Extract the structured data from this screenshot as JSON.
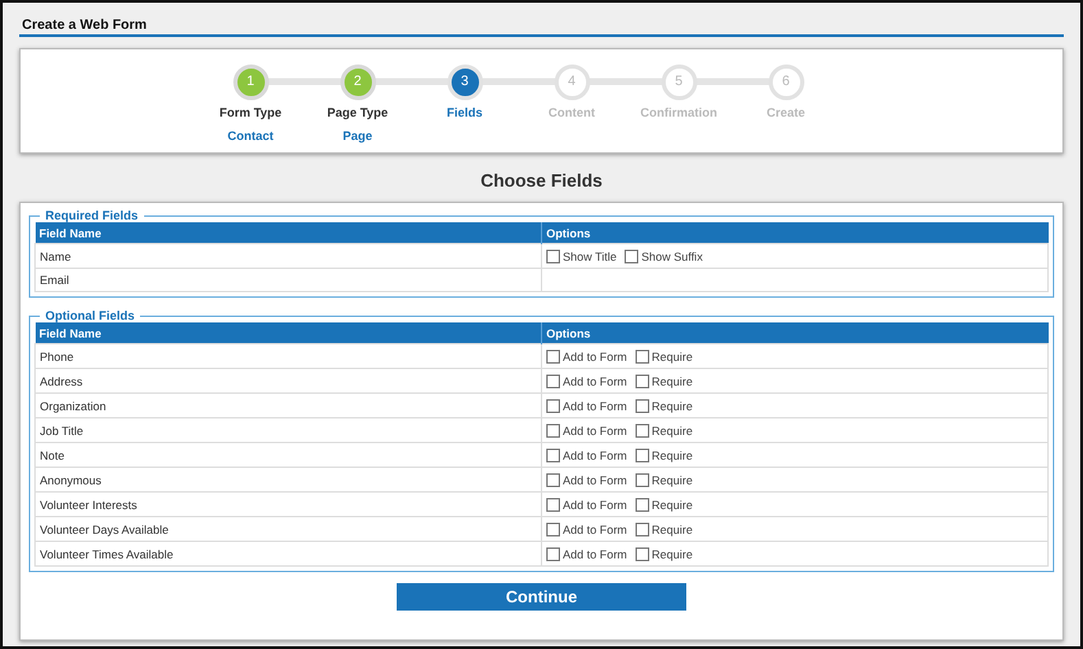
{
  "header": {
    "title": "Create a Web Form"
  },
  "steps": [
    {
      "number": "1",
      "label": "Form Type",
      "value": "Contact",
      "completed": true,
      "selected": false
    },
    {
      "number": "2",
      "label": "Page Type",
      "value": "Page",
      "completed": true,
      "selected": false
    },
    {
      "number": "3",
      "label": "Fields",
      "completed": false,
      "selected": true
    },
    {
      "number": "4",
      "label": "Content",
      "completed": false,
      "selected": false
    },
    {
      "number": "5",
      "label": "Confirmation",
      "completed": false,
      "selected": false
    },
    {
      "number": "6",
      "label": "Create",
      "completed": false,
      "selected": false
    }
  ],
  "heading": "Choose Fields",
  "sections": [
    {
      "legend": "Required Fields",
      "columns": [
        "Field Name",
        "Options"
      ],
      "rows": [
        {
          "name": "Name",
          "options": [
            {
              "label": "Show Title",
              "checked": false
            },
            {
              "label": "Show Suffix",
              "checked": false
            }
          ]
        },
        {
          "name": "Email"
        }
      ]
    },
    {
      "legend": "Optional Fields",
      "columns": [
        "Field Name",
        "Options"
      ],
      "rows": [
        {
          "name": "Phone",
          "options": [
            {
              "label": "Add to Form",
              "checked": false
            },
            {
              "label": "Require",
              "checked": false
            }
          ]
        },
        {
          "name": "Address",
          "options": [
            {
              "label": "Add to Form",
              "checked": false
            },
            {
              "label": "Require",
              "checked": false
            }
          ]
        },
        {
          "name": "Organization",
          "options": [
            {
              "label": "Add to Form",
              "checked": false
            },
            {
              "label": "Require",
              "checked": false
            }
          ]
        },
        {
          "name": "Job Title",
          "options": [
            {
              "label": "Add to Form",
              "checked": false
            },
            {
              "label": "Require",
              "checked": false
            }
          ]
        },
        {
          "name": "Note",
          "options": [
            {
              "label": "Add to Form",
              "checked": false
            },
            {
              "label": "Require",
              "checked": false
            }
          ]
        },
        {
          "name": "Anonymous",
          "options": [
            {
              "label": "Add to Form",
              "checked": false
            },
            {
              "label": "Require",
              "checked": false
            }
          ]
        },
        {
          "name": "Volunteer Interests",
          "options": [
            {
              "label": "Add to Form",
              "checked": false
            },
            {
              "label": "Require",
              "checked": false
            }
          ]
        },
        {
          "name": "Volunteer Days Available",
          "options": [
            {
              "label": "Add to Form",
              "checked": false
            },
            {
              "label": "Require",
              "checked": false
            }
          ]
        },
        {
          "name": "Volunteer Times Available",
          "options": [
            {
              "label": "Add to Form",
              "checked": false
            },
            {
              "label": "Require",
              "checked": false
            }
          ]
        }
      ]
    }
  ],
  "button": "Continue"
}
